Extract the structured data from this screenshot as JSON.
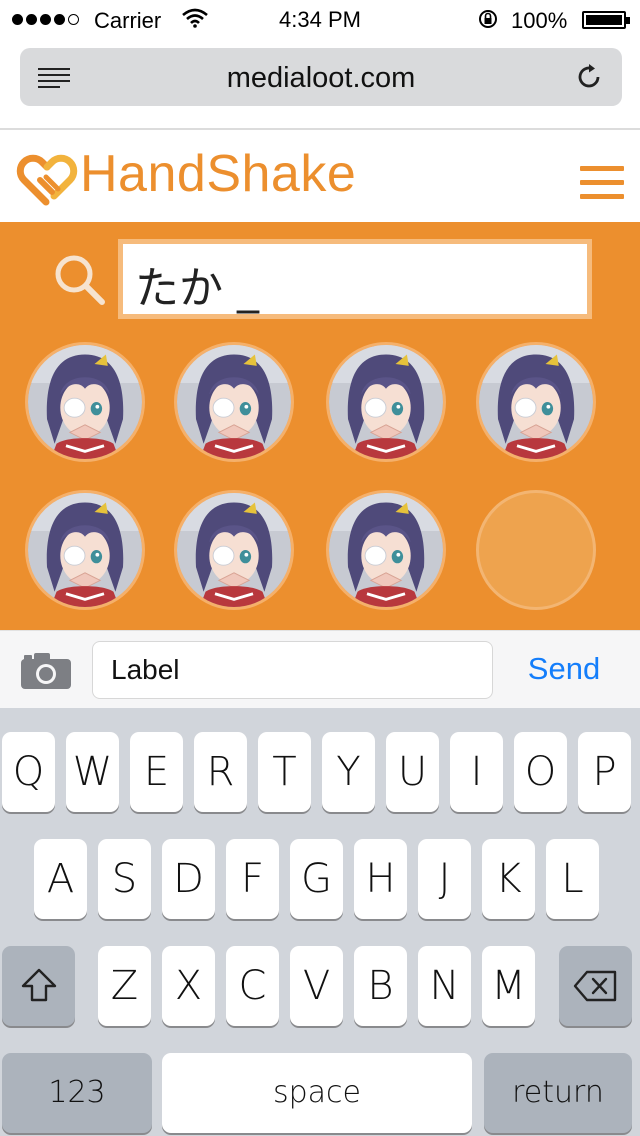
{
  "status_bar": {
    "carrier": "Carrier",
    "time": "4:34 PM",
    "battery_percent": "100%",
    "signal_bars_filled": 4,
    "signal_bars_total": 5,
    "icons": [
      "signal-dots-icon",
      "wifi-icon",
      "orientation-lock-icon",
      "battery-icon"
    ]
  },
  "browser": {
    "url": "medialoot.com",
    "icons": [
      "reader-icon",
      "reload-icon"
    ]
  },
  "header": {
    "logo_text": "HandShake",
    "icons": [
      "handshake-heart-logo-icon",
      "hamburger-menu-icon"
    ]
  },
  "search": {
    "query": "たか _"
  },
  "avatars": {
    "filled_count": 7,
    "total_slots": 8
  },
  "compose": {
    "label_value": "Label",
    "send_label": "Send"
  },
  "keyboard": {
    "row1": [
      "Q",
      "W",
      "E",
      "R",
      "T",
      "Y",
      "U",
      "I",
      "O",
      "P"
    ],
    "row2": [
      "A",
      "S",
      "D",
      "F",
      "G",
      "H",
      "J",
      "K",
      "L"
    ],
    "row3": [
      "Z",
      "X",
      "C",
      "V",
      "B",
      "N",
      "M"
    ],
    "numbers_label": "123",
    "space_label": "space",
    "return_label": "return"
  },
  "colors": {
    "brand_orange": "#ec8f2e",
    "send_blue": "#147efb",
    "keyboard_bg": "#d1d5db"
  }
}
